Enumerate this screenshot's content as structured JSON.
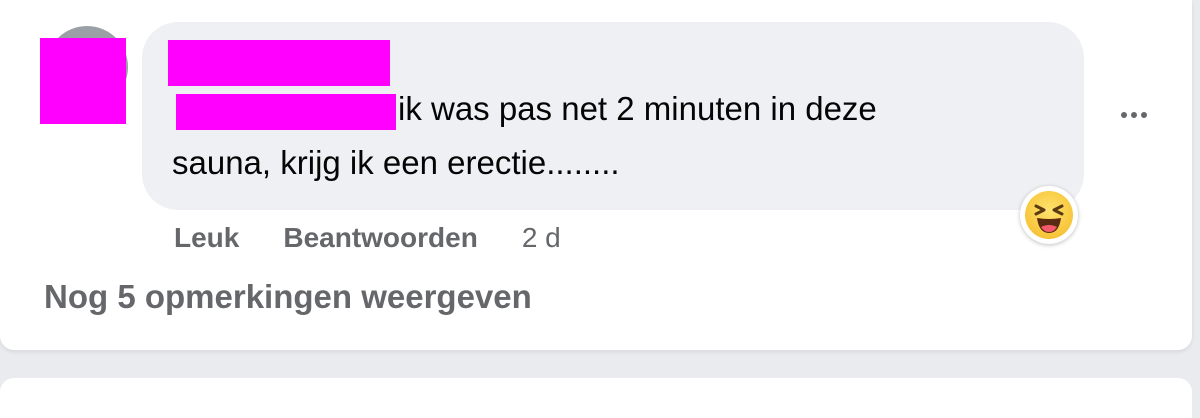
{
  "comment": {
    "text_line1": "ik was pas net 2 minuten in deze",
    "text_line2": "sauna, krijg ik een erectie........",
    "reaction_icon": "haha-emoji-icon",
    "redaction_color": "#ff00ff"
  },
  "actions": {
    "like_label": "Leuk",
    "reply_label": "Beantwoorden",
    "timestamp": "2 d"
  },
  "more_comments_label": "Nog 5 opmerkingen weergeven",
  "colors": {
    "bubble": "#eef0f3",
    "secondary_text": "#65676b",
    "primary_text": "#050505"
  }
}
